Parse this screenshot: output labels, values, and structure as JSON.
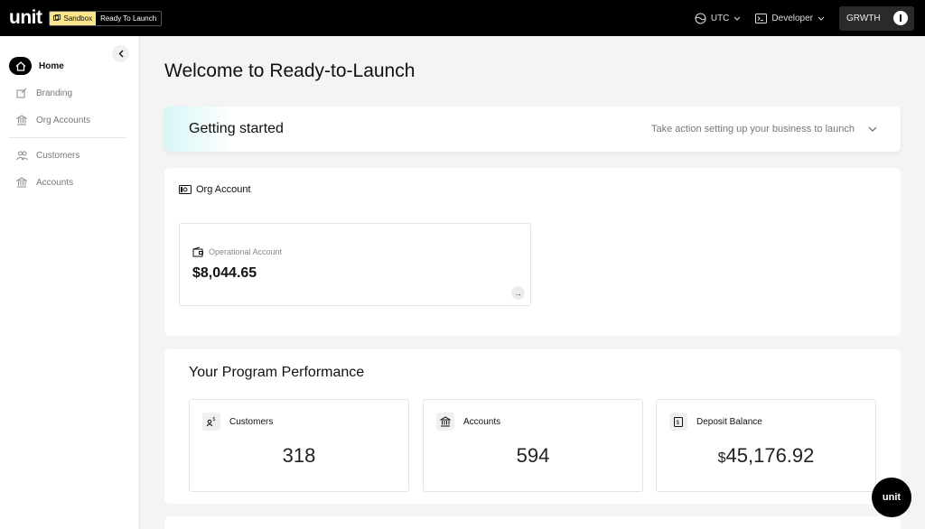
{
  "topbar": {
    "logo": "unit",
    "env_badge": "Sandbox",
    "org_label": "Ready To Launch",
    "timezone": "UTC",
    "developer": "Developer",
    "org_switch": "GRWTH"
  },
  "sidebar": {
    "items": [
      {
        "label": "Home",
        "icon": "home-icon"
      },
      {
        "label": "Branding",
        "icon": "branding-icon"
      },
      {
        "label": "Org Accounts",
        "icon": "bank-icon"
      },
      {
        "label": "Customers",
        "icon": "users-icon"
      },
      {
        "label": "Accounts",
        "icon": "bank-icon"
      }
    ]
  },
  "main": {
    "title": "Welcome to Ready-to-Launch",
    "getting_started": {
      "title": "Getting started",
      "hint": "Take action setting up your business to launch"
    },
    "org_account": {
      "heading": "Org Account",
      "account_label": "Operational Account",
      "balance": "$8,044.65"
    },
    "performance": {
      "title": "Your Program Performance",
      "metrics": [
        {
          "label": "Customers",
          "value": "318"
        },
        {
          "label": "Accounts",
          "value": "594"
        },
        {
          "label": "Deposit Balance",
          "currency": "$",
          "value": "45,176.92"
        }
      ]
    }
  },
  "fab": {
    "label": "unit"
  },
  "colors": {
    "topbar": "#000000",
    "sandbox_badge": "#fbe58b",
    "accent": "#000000"
  }
}
